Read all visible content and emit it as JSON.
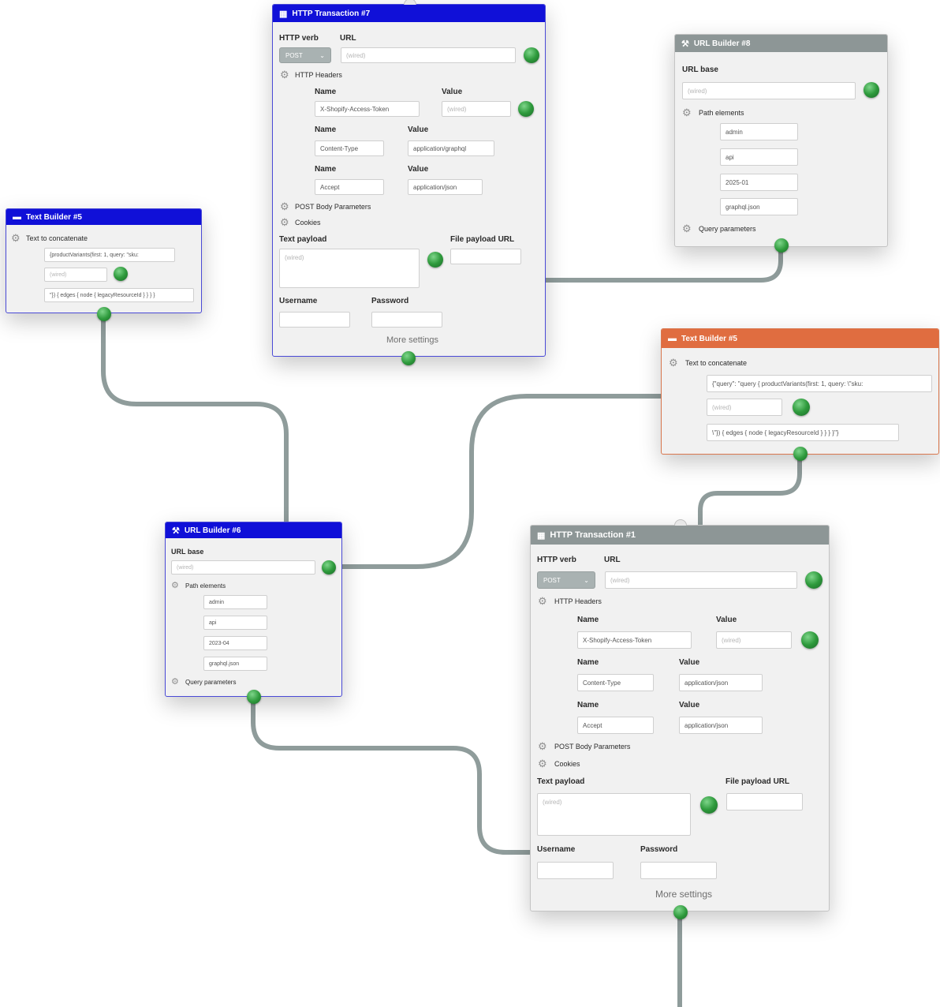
{
  "colors": {
    "wire": "#8f9c9b",
    "blue_header": "#1010d8",
    "gray_header": "#8d9696",
    "orange_header": "#e06d40",
    "port": "#2e9a3c"
  },
  "nodes": {
    "http7": {
      "icon": "transaction-icon",
      "title": "HTTP Transaction #7",
      "verb_label": "HTTP verb",
      "url_label": "URL",
      "verb_value": "POST",
      "url_placeholder": "(wired)",
      "headers_label": "HTTP Headers",
      "headers": [
        {
          "name_label": "Name",
          "value_label": "Value",
          "name": "X-Shopify-Access-Token",
          "value_placeholder": "(wired)"
        },
        {
          "name_label": "Name",
          "value_label": "Value",
          "name": "Content-Type",
          "value": "application/graphql"
        },
        {
          "name_label": "Name",
          "value_label": "Value",
          "name": "Accept",
          "value": "application/json"
        }
      ],
      "post_body_label": "POST Body Parameters",
      "cookies_label": "Cookies",
      "text_payload_label": "Text payload",
      "text_payload_placeholder": "(wired)",
      "file_payload_label": "File payload URL",
      "username_label": "Username",
      "password_label": "Password",
      "more_settings": "More settings"
    },
    "url8": {
      "icon": "url-builder-icon",
      "title": "URL Builder #8",
      "base_label": "URL base",
      "base_placeholder": "(wired)",
      "path_label": "Path elements",
      "paths": [
        "admin",
        "api",
        "2025-01",
        "graphql.json"
      ],
      "query_label": "Query parameters"
    },
    "text_left": {
      "icon": "text-builder-icon",
      "title": "Text Builder #5",
      "concat_label": "Text to concatenate",
      "part1": "{productVariants(first: 1, query: \"sku:",
      "wired_placeholder": "(wired)",
      "part3": "\"}) { edges { node { legacyResourceId } } } }"
    },
    "text5": {
      "icon": "text-builder-icon",
      "title": "Text Builder #5",
      "concat_label": "Text to concatenate",
      "part1": "{\"query\": \"query { productVariants(first: 1, query: \\\"sku:",
      "wired_placeholder": "(wired)",
      "part3": "\\\"}) { edges { node { legacyResourceId } } } }\"}"
    },
    "url6": {
      "icon": "url-builder-icon",
      "title": "URL Builder #6",
      "base_label": "URL base",
      "base_placeholder": "(wired)",
      "path_label": "Path elements",
      "paths": [
        "admin",
        "api",
        "2023-04",
        "graphql.json"
      ],
      "query_label": "Query parameters"
    },
    "http1": {
      "icon": "transaction-icon",
      "title": "HTTP Transaction #1",
      "verb_label": "HTTP verb",
      "url_label": "URL",
      "verb_value": "POST",
      "url_placeholder": "(wired)",
      "headers_label": "HTTP Headers",
      "headers": [
        {
          "name_label": "Name",
          "value_label": "Value",
          "name": "X-Shopify-Access-Token",
          "value_placeholder": "(wired)"
        },
        {
          "name_label": "Name",
          "value_label": "Value",
          "name": "Content-Type",
          "value": "application/json"
        },
        {
          "name_label": "Name",
          "value_label": "Value",
          "name": "Accept",
          "value": "application/json"
        }
      ],
      "post_body_label": "POST Body Parameters",
      "cookies_label": "Cookies",
      "text_payload_label": "Text payload",
      "text_payload_placeholder": "(wired)",
      "file_payload_label": "File payload URL",
      "username_label": "Username",
      "password_label": "Password",
      "more_settings": "More settings"
    }
  }
}
